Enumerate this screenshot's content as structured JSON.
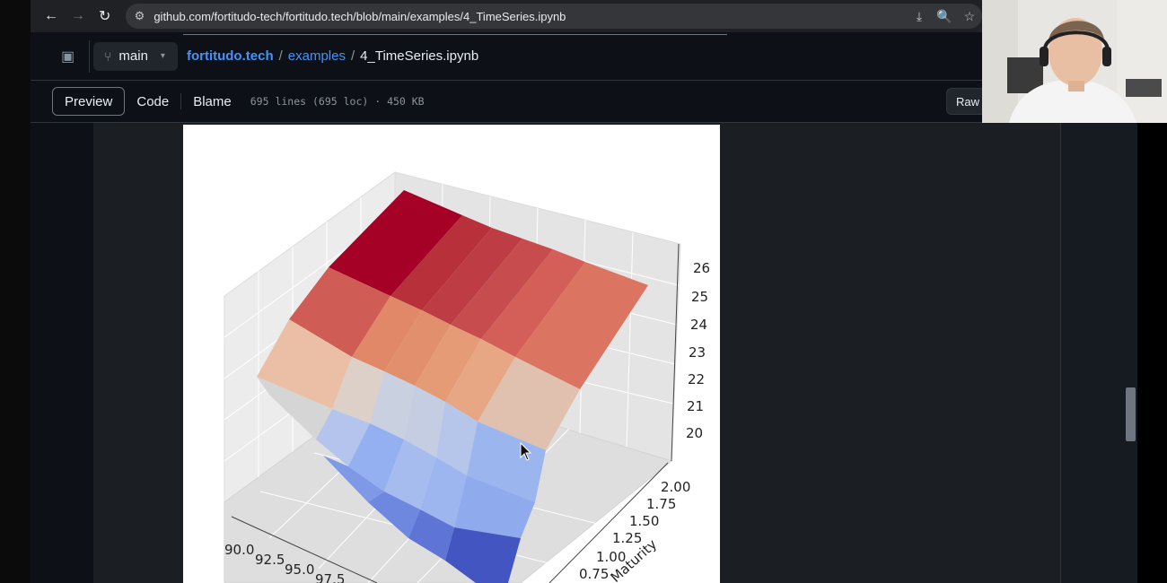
{
  "browser": {
    "url": "github.com/fortitudo-tech/fortitudo.tech/blob/main/examples/4_TimeSeries.ipynb",
    "back_icon": "←",
    "forward_icon": "→",
    "reload_icon": "↻",
    "tune_icon": "⚙",
    "install_icon": "⤓",
    "zoom_icon": "🔍",
    "star_icon": "☆"
  },
  "repo_header": {
    "panel_icon": "▣",
    "branch_icon": "⑂",
    "branch_name": "main",
    "caret": "▾",
    "repo_name": "fortitudo.tech",
    "separator": "/",
    "folder": "examples",
    "file_name": "4_TimeSeries.ipynb"
  },
  "file_toolbar": {
    "tabs": [
      "Preview",
      "Code",
      "Blame"
    ],
    "active_tab": "Preview",
    "file_info": "695 lines (695 loc) · 450 KB",
    "raw_label": "Raw"
  },
  "chart_data": {
    "type": "surface",
    "colormap": "coolwarm",
    "z_ticks": [
      "20",
      "21",
      "22",
      "23",
      "24",
      "25",
      "26"
    ],
    "y_ticks": [
      "0.75",
      "1.00",
      "1.25",
      "1.50",
      "1.75",
      "2.00"
    ],
    "x_ticks": [
      "90.0",
      "92.5",
      "95.0",
      "97.5"
    ],
    "y_label": "Maturity"
  }
}
